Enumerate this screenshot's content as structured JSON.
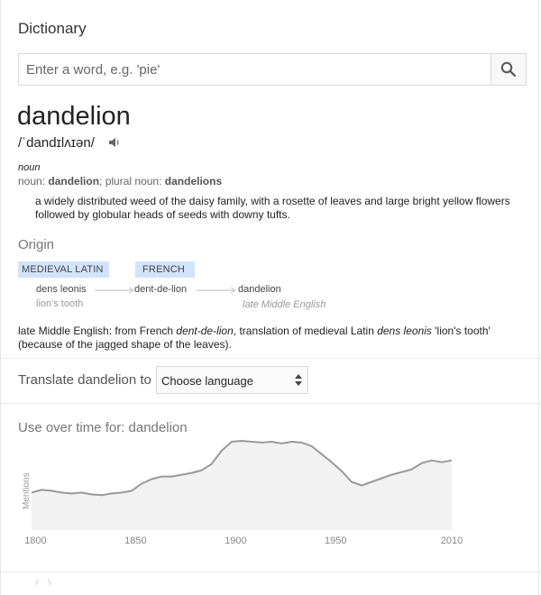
{
  "header": {
    "title": "Dictionary"
  },
  "search": {
    "placeholder": "Enter a word, e.g. 'pie'",
    "value": "",
    "icon": "search-icon"
  },
  "entry": {
    "word": "dandelion",
    "pronunciation": "/ˈdandɪlʌɪən/",
    "part_of_speech": "noun",
    "forms": {
      "noun_label": "noun:",
      "noun": "dandelion",
      "plural_label": "; plural noun:",
      "plural": "dandelions"
    },
    "definition": "a widely distributed weed of the daisy family, with a rosette of leaves and large bright yellow flowers followed by globular heads of seeds with downy tufts."
  },
  "origin": {
    "heading": "Origin",
    "languages": [
      "MEDIEVAL LATIN",
      "FRENCH"
    ],
    "chain": [
      {
        "form": "dens leonis",
        "gloss": "lion's tooth"
      },
      {
        "form": "dent-de-lion",
        "gloss": ""
      },
      {
        "form": "dandelion",
        "gloss": "late Middle English"
      }
    ],
    "note_parts": {
      "a": "late Middle English: from French ",
      "b": "dent-de-lion",
      "c": ", translation of medieval Latin ",
      "d": "dens leonis",
      "e": " 'lion's tooth' (because of the jagged shape of the leaves)."
    }
  },
  "translate": {
    "label": "Translate dandelion to",
    "selected": "Choose language"
  },
  "usage": {
    "heading": "Use over time for: dandelion",
    "chart_data": {
      "type": "area",
      "ylabel": "Mentions",
      "xlabel": "",
      "x_ticks": [
        "1800",
        "1850",
        "1900",
        "1950",
        "2010"
      ],
      "xlim": [
        1800,
        2010
      ],
      "ylim": [
        0,
        100
      ],
      "x": [
        1800,
        1805,
        1810,
        1815,
        1820,
        1825,
        1830,
        1835,
        1840,
        1845,
        1850,
        1855,
        1860,
        1865,
        1870,
        1875,
        1880,
        1885,
        1890,
        1895,
        1900,
        1905,
        1910,
        1915,
        1920,
        1925,
        1930,
        1935,
        1940,
        1945,
        1950,
        1955,
        1960,
        1965,
        1970,
        1975,
        1980,
        1985,
        1990,
        1995,
        2000,
        2005,
        2010
      ],
      "values": [
        38,
        41,
        40,
        38,
        37,
        38,
        36,
        35,
        37,
        38,
        40,
        48,
        53,
        56,
        56,
        58,
        60,
        63,
        70,
        85,
        95,
        96,
        95,
        94,
        95,
        93,
        95,
        94,
        90,
        81,
        72,
        62,
        50,
        46,
        50,
        54,
        58,
        61,
        64,
        71,
        74,
        72,
        74
      ],
      "line_color": "#999999",
      "fill_color": "#f2f2f2"
    }
  }
}
